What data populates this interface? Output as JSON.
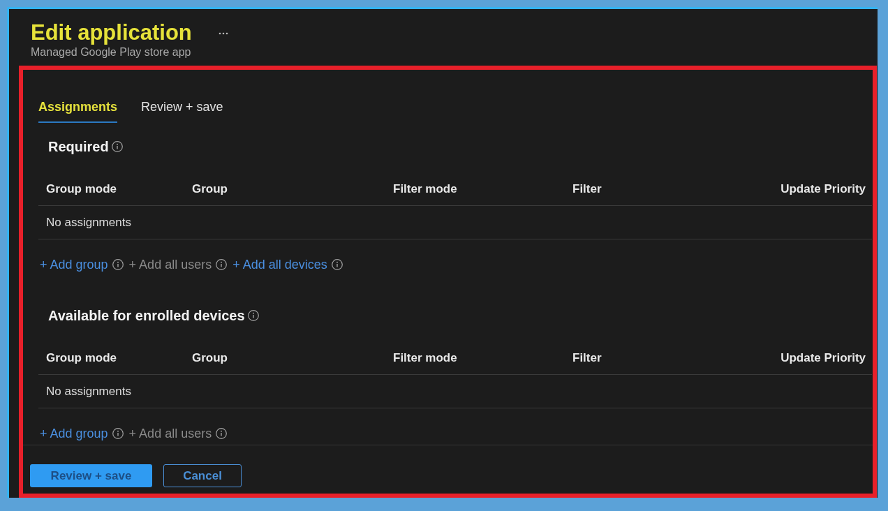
{
  "header": {
    "title": "Edit application",
    "subtitle": "Managed Google Play store app"
  },
  "tabs": [
    {
      "label": "Assignments",
      "selected": true
    },
    {
      "label": "Review + save",
      "selected": false
    }
  ],
  "sections": [
    {
      "title": "Required",
      "columns": [
        "Group mode",
        "Group",
        "Filter mode",
        "Filter",
        "Update Priority"
      ],
      "empty_text": "No assignments",
      "actions": [
        {
          "label": "+ Add group",
          "disabled": false
        },
        {
          "label": "+ Add all users",
          "disabled": true
        },
        {
          "label": "+ Add all devices",
          "disabled": false
        }
      ]
    },
    {
      "title": "Available for enrolled devices",
      "columns": [
        "Group mode",
        "Group",
        "Filter mode",
        "Filter",
        "Update Priority"
      ],
      "empty_text": "No assignments",
      "actions": [
        {
          "label": "+ Add group",
          "disabled": false
        },
        {
          "label": "+ Add all users",
          "disabled": true
        }
      ]
    }
  ],
  "buttons": [
    {
      "label": "Review + save",
      "kind": "primary"
    },
    {
      "label": "Cancel",
      "kind": "secondary"
    }
  ]
}
